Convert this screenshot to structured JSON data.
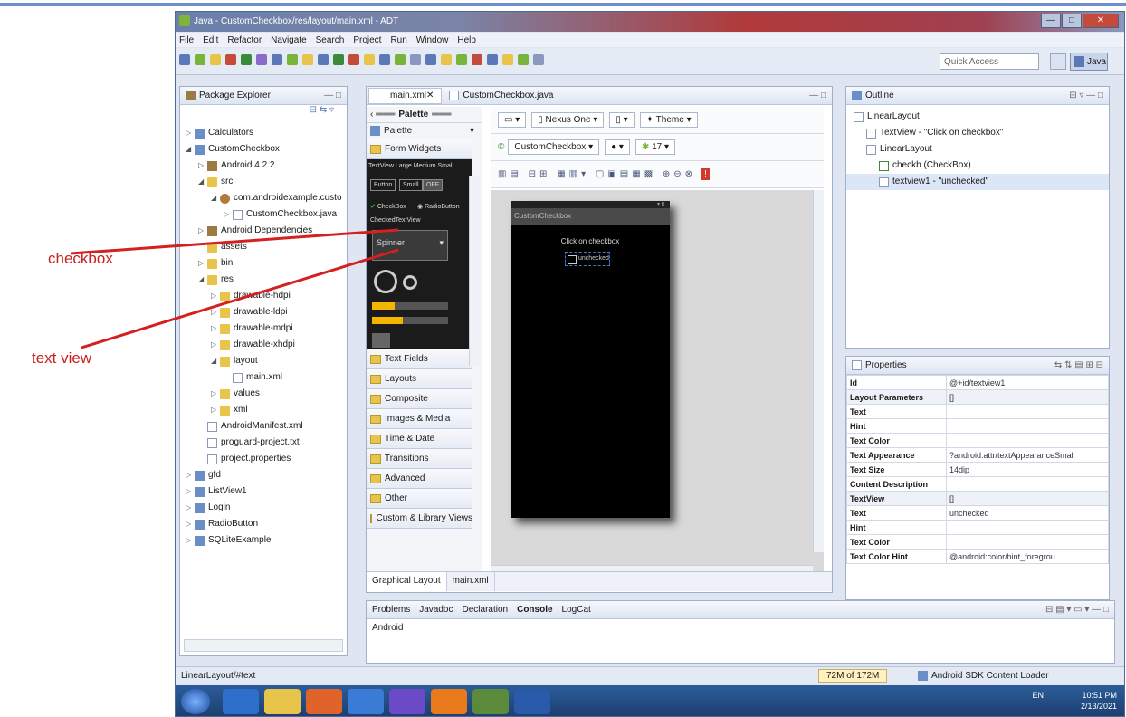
{
  "window": {
    "title": "Java - CustomCheckbox/res/layout/main.xml - ADT",
    "btn_min": "—",
    "btn_max": "□",
    "btn_close": "✕"
  },
  "menu": [
    "File",
    "Edit",
    "Refactor",
    "Navigate",
    "Search",
    "Project",
    "Run",
    "Window",
    "Help"
  ],
  "toolbar": {
    "quick_access": "Quick Access",
    "java_perspective": "Java"
  },
  "package_explorer": {
    "title": "Package Explorer",
    "items": [
      {
        "label": "Calculators",
        "depth": 0,
        "type": "proj",
        "twisty": "▷"
      },
      {
        "label": "CustomCheckbox",
        "depth": 0,
        "type": "proj",
        "twisty": "◢"
      },
      {
        "label": "Android 4.2.2",
        "depth": 1,
        "type": "jar",
        "twisty": "▷"
      },
      {
        "label": "src",
        "depth": 1,
        "type": "fold",
        "twisty": "◢"
      },
      {
        "label": "com.androidexample.custo",
        "depth": 2,
        "type": "pkg",
        "twisty": "◢"
      },
      {
        "label": "CustomCheckbox.java",
        "depth": 3,
        "type": "file",
        "twisty": "▷"
      },
      {
        "label": "Android Dependencies",
        "depth": 1,
        "type": "jar",
        "twisty": "▷"
      },
      {
        "label": "assets",
        "depth": 1,
        "type": "fold",
        "twisty": ""
      },
      {
        "label": "bin",
        "depth": 1,
        "type": "fold",
        "twisty": "▷"
      },
      {
        "label": "res",
        "depth": 1,
        "type": "fold",
        "twisty": "◢"
      },
      {
        "label": "drawable-hdpi",
        "depth": 2,
        "type": "fold",
        "twisty": "▷"
      },
      {
        "label": "drawable-ldpi",
        "depth": 2,
        "type": "fold",
        "twisty": "▷"
      },
      {
        "label": "drawable-mdpi",
        "depth": 2,
        "type": "fold",
        "twisty": "▷"
      },
      {
        "label": "drawable-xhdpi",
        "depth": 2,
        "type": "fold",
        "twisty": "▷"
      },
      {
        "label": "layout",
        "depth": 2,
        "type": "fold",
        "twisty": "◢"
      },
      {
        "label": "main.xml",
        "depth": 3,
        "type": "file",
        "twisty": ""
      },
      {
        "label": "values",
        "depth": 2,
        "type": "fold",
        "twisty": "▷"
      },
      {
        "label": "xml",
        "depth": 2,
        "type": "fold",
        "twisty": "▷"
      },
      {
        "label": "AndroidManifest.xml",
        "depth": 1,
        "type": "file",
        "twisty": ""
      },
      {
        "label": "proguard-project.txt",
        "depth": 1,
        "type": "file",
        "twisty": ""
      },
      {
        "label": "project.properties",
        "depth": 1,
        "type": "file",
        "twisty": ""
      },
      {
        "label": "gfd",
        "depth": 0,
        "type": "proj",
        "twisty": "▷"
      },
      {
        "label": "ListView1",
        "depth": 0,
        "type": "proj",
        "twisty": "▷"
      },
      {
        "label": "Login",
        "depth": 0,
        "type": "proj",
        "twisty": "▷"
      },
      {
        "label": "RadioButton",
        "depth": 0,
        "type": "proj",
        "twisty": "▷"
      },
      {
        "label": "SQLiteExample",
        "depth": 0,
        "type": "proj",
        "twisty": "▷"
      }
    ]
  },
  "editor": {
    "tabs": [
      "main.xml",
      "CustomCheckbox.java"
    ],
    "palette_header": "Palette",
    "palette_label": "Palette",
    "form_widgets": "Form Widgets",
    "widget_sizes": "TextView Large Medium Small",
    "widget_buttons": [
      "Button",
      "Small",
      "OFF"
    ],
    "widget_checkbox": "CheckBox",
    "widget_radio": "RadioButton",
    "widget_checkedtext": "CheckedTextView",
    "widget_spinner": "Spinner",
    "sections": [
      "Text Fields",
      "Layouts",
      "Composite",
      "Images & Media",
      "Time & Date",
      "Transitions",
      "Advanced",
      "Other",
      "Custom & Library Views"
    ],
    "device": "Nexus One",
    "theme": "Theme",
    "activity": "CustomCheckbox",
    "api": "17",
    "phone_title": "CustomCheckbox",
    "phone_text": "Click on checkbox",
    "phone_checkbox": "unchecked",
    "bottom_tabs": [
      "Graphical Layout",
      "main.xml"
    ]
  },
  "outline": {
    "title": "Outline",
    "nodes": [
      {
        "label": "LinearLayout",
        "depth": 0
      },
      {
        "label": "TextView - \"Click on checkbox\"",
        "depth": 1
      },
      {
        "label": "LinearLayout",
        "depth": 1
      },
      {
        "label": "checkb (CheckBox)",
        "depth": 2
      },
      {
        "label": "textview1 - \"unchecked\"",
        "depth": 2
      }
    ]
  },
  "properties": {
    "title": "Properties",
    "rows": [
      {
        "k": "Id",
        "v": "@+id/textview1",
        "grp": false
      },
      {
        "k": "Layout Parameters",
        "v": "[]",
        "grp": true
      },
      {
        "k": "Text",
        "v": "",
        "grp": false
      },
      {
        "k": "Hint",
        "v": "",
        "grp": false
      },
      {
        "k": "Text Color",
        "v": "",
        "grp": false
      },
      {
        "k": "Text Appearance",
        "v": "?android:attr/textAppearanceSmall",
        "grp": false
      },
      {
        "k": "Text Size",
        "v": "14dip",
        "grp": false
      },
      {
        "k": "Content Description",
        "v": "",
        "grp": false
      },
      {
        "k": "TextView",
        "v": "[]",
        "grp": true
      },
      {
        "k": "Text",
        "v": "unchecked",
        "grp": false
      },
      {
        "k": "Hint",
        "v": "",
        "grp": false
      },
      {
        "k": "Text Color",
        "v": "",
        "grp": false
      },
      {
        "k": "Text Color Hint",
        "v": "@android:color/hint_foregrou...",
        "grp": false
      }
    ]
  },
  "console": {
    "tabs": [
      "Problems",
      "Javadoc",
      "Declaration",
      "Console",
      "LogCat"
    ],
    "text": "Android"
  },
  "status": {
    "left": "LinearLayout/#text",
    "memory": "72M of 172M",
    "sdk": "Android SDK Content Loader"
  },
  "tray": {
    "lang": "EN",
    "time": "10:51 PM",
    "date": "2/13/2021"
  },
  "annotations": {
    "checkbox": "checkbox",
    "textview": "text view"
  },
  "colors": {
    "annotation": "#d42020",
    "title_bar": "#b03a3a",
    "taskbar": "#1c3d6e"
  }
}
